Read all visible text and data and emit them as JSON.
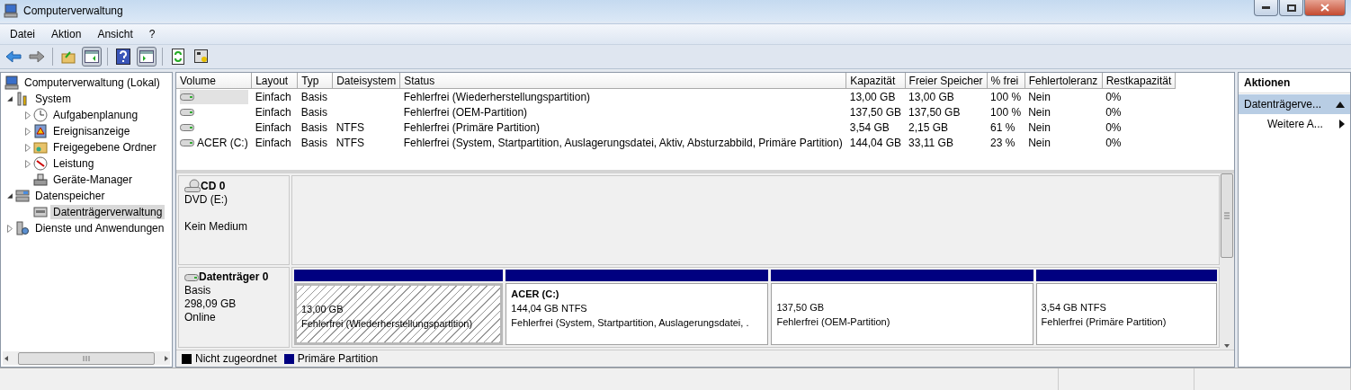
{
  "window": {
    "title": "Computerverwaltung"
  },
  "menu": [
    "Datei",
    "Aktion",
    "Ansicht",
    "?"
  ],
  "tree": [
    {
      "label": "Computerverwaltung (Lokal)",
      "kind": "root",
      "selected": false,
      "children": [
        {
          "label": "System",
          "kind": "branch",
          "expanded": true,
          "selected": false,
          "children": [
            {
              "label": "Aufgabenplanung",
              "kind": "branch",
              "expanded": false,
              "selected": false
            },
            {
              "label": "Ereignisanzeige",
              "kind": "branch",
              "expanded": false,
              "selected": false
            },
            {
              "label": "Freigegebene Ordner",
              "kind": "branch",
              "expanded": false,
              "selected": false
            },
            {
              "label": "Leistung",
              "kind": "branch",
              "expanded": false,
              "selected": false
            },
            {
              "label": "Geräte-Manager",
              "kind": "leaf",
              "selected": false
            }
          ]
        },
        {
          "label": "Datenspeicher",
          "kind": "branch",
          "expanded": true,
          "selected": false,
          "children": [
            {
              "label": "Datenträgerverwaltung",
              "kind": "leaf",
              "selected": true
            }
          ]
        },
        {
          "label": "Dienste und Anwendungen",
          "kind": "branch",
          "expanded": false,
          "selected": false
        }
      ]
    }
  ],
  "table": {
    "columns": [
      "Volume",
      "Layout",
      "Typ",
      "Dateisystem",
      "Status",
      "Kapazität",
      "Freier Speicher",
      "% frei",
      "Fehlertoleranz",
      "Restkapazität"
    ],
    "rows": [
      {
        "selected": true,
        "cells": [
          "",
          "Einfach",
          "Basis",
          "",
          "Fehlerfrei (Wiederherstellungspartition)",
          "13,00 GB",
          "13,00 GB",
          "100 %",
          "Nein",
          "0%"
        ]
      },
      {
        "selected": false,
        "cells": [
          "",
          "Einfach",
          "Basis",
          "",
          "Fehlerfrei (OEM-Partition)",
          "137,50 GB",
          "137,50 GB",
          "100 %",
          "Nein",
          "0%"
        ]
      },
      {
        "selected": false,
        "cells": [
          "",
          "Einfach",
          "Basis",
          "NTFS",
          "Fehlerfrei (Primäre Partition)",
          "3,54 GB",
          "2,15 GB",
          "61 %",
          "Nein",
          "0%"
        ]
      },
      {
        "selected": false,
        "cells": [
          "ACER (C:)",
          "Einfach",
          "Basis",
          "NTFS",
          "Fehlerfrei (System, Startpartition, Auslagerungsdatei, Aktiv, Absturzabbild, Primäre Partition)",
          "144,04 GB",
          "33,11 GB",
          "23 %",
          "Nein",
          "0%"
        ]
      }
    ]
  },
  "disks": [
    {
      "kind": "cdrom",
      "name": "CD 0",
      "lines": [
        "DVD (E:)",
        "Kein Medium"
      ]
    },
    {
      "kind": "disk",
      "name": "Datenträger 0",
      "lines": [
        "Basis",
        "298,09 GB",
        "Online"
      ],
      "partitions": [
        {
          "selected": true,
          "size": "13,00 GB",
          "status": "Fehlerfrei (Wiederherstellungspartition)",
          "color": "#000080"
        },
        {
          "selected": false,
          "title": "ACER  (C:)",
          "size": "144,04 GB NTFS",
          "status": "Fehlerfrei (System, Startpartition, Auslagerungsdatei, .",
          "color": "#000080"
        },
        {
          "selected": false,
          "size": "137,50 GB",
          "status": "Fehlerfrei (OEM-Partition)",
          "color": "#000080"
        },
        {
          "selected": false,
          "size": "3,54 GB NTFS",
          "status": "Fehlerfrei (Primäre Partition)",
          "color": "#000080"
        }
      ]
    }
  ],
  "legend": [
    {
      "label": "Nicht zugeordnet",
      "color": "#000000"
    },
    {
      "label": "Primäre Partition",
      "color": "#000080"
    }
  ],
  "actions": {
    "title": "Aktionen",
    "items": [
      {
        "kind": "section",
        "label": "Datenträgerve..."
      },
      {
        "kind": "item",
        "label": "Weitere A..."
      }
    ]
  }
}
